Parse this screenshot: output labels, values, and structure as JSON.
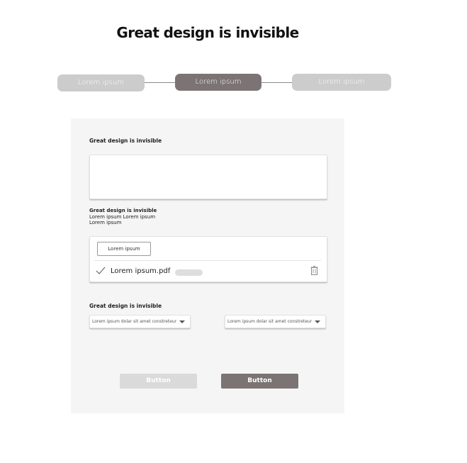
{
  "page": {
    "title": "Great design is invisible"
  },
  "stepper": {
    "steps": [
      {
        "label": "Lorem ipsum",
        "state": "inactive"
      },
      {
        "label": "Lorem ipsum",
        "state": "active"
      },
      {
        "label": "Lorem ipsum",
        "state": "inactive"
      }
    ]
  },
  "form": {
    "section1_title": "Great design is invisible",
    "textarea_value": "",
    "upload": {
      "title": "Great design is invisible",
      "desc_line1": "Lorem ipsum Lorem ipsum",
      "desc_line2": "Lorem ipsum",
      "button_label": "Lorem ipsum",
      "file_name": "Lorem ipsum.pdf"
    },
    "section3_title": "Great design is invisible",
    "selects": [
      {
        "value": "Lorem ipsum dolar sit amet constreteur"
      },
      {
        "value": "Lorem ipsum dolar sit amet constreteur"
      }
    ],
    "buttons": {
      "secondary_label": "Button",
      "primary_label": "Button"
    }
  },
  "colors": {
    "accent": "#7c7474",
    "inactive": "#cccccc",
    "card_bg": "#f5f5f5",
    "disabled_button": "#dadada"
  },
  "icons": {
    "check": "check-icon",
    "trash": "trash-icon",
    "caret": "chevron-down-icon"
  }
}
